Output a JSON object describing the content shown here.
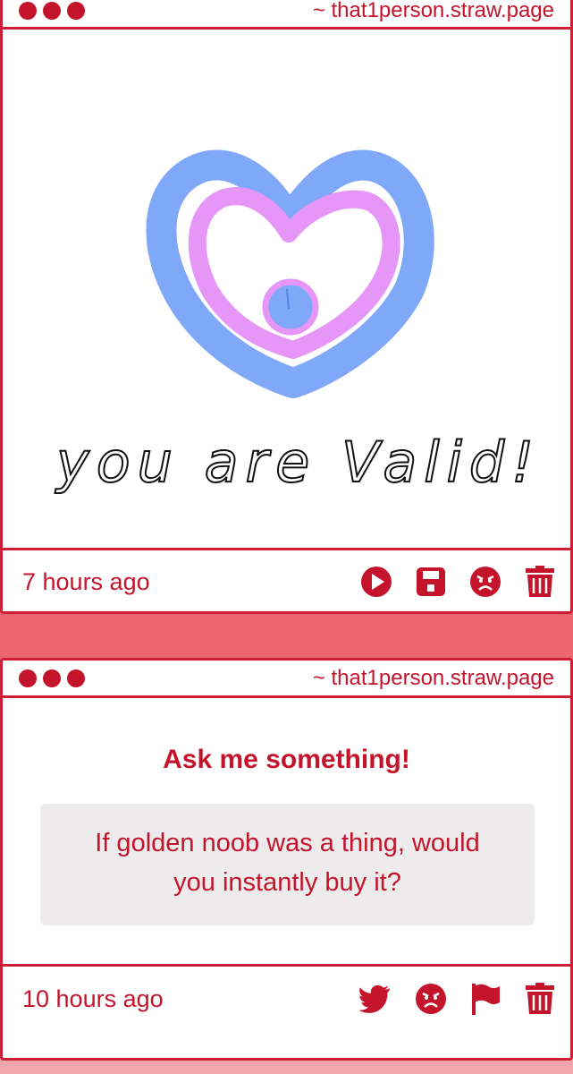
{
  "cards": [
    {
      "host": "~ that1person.straw.page",
      "drawing_text": "you are Valid!",
      "timestamp": "7 hours ago",
      "actions": [
        "play-icon",
        "save-icon",
        "angry-face-icon",
        "trash-icon"
      ]
    },
    {
      "host": "~ that1person.straw.page",
      "title": "Ask me something!",
      "question": "If golden noob was a thing, would you instantly buy it?",
      "timestamp": "10 hours ago",
      "actions": [
        "twitter-icon",
        "angry-face-icon",
        "flag-icon",
        "trash-icon"
      ]
    }
  ],
  "colors": {
    "accent": "#c4142c",
    "background": "#ec6670",
    "heart_outer": "#7fa8f8",
    "heart_inner": "#e596f6"
  }
}
